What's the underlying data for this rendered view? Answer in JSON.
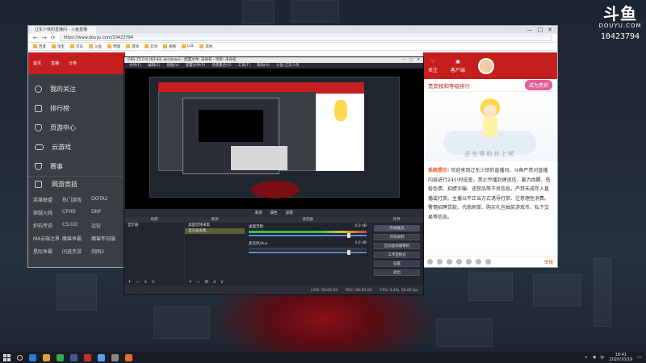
{
  "watermark": {
    "logo": "斗鱼",
    "site": "DOUYU.COM",
    "room": "10423794"
  },
  "browser": {
    "tab_title": "辽东少侠的直播间 - 斗鱼直播",
    "window_controls": [
      "—",
      "□",
      "✕"
    ],
    "nav": [
      "←",
      "→",
      "⟳"
    ],
    "url": "https://www.douyu.com/10423794",
    "bookmarks": [
      "百度",
      "淘宝",
      "京东",
      "斗鱼",
      "哔哩",
      "游戏",
      "云顶",
      "视频",
      "LOL",
      "其他"
    ]
  },
  "douyu_left": {
    "logo": "斗鱼",
    "topbar_items": [
      "首页",
      "直播",
      "分类"
    ],
    "nav": [
      {
        "icon": "heart-icon",
        "label": "我的关注"
      },
      {
        "icon": "rank-icon",
        "label": "排行榜"
      },
      {
        "icon": "shield-icon",
        "label": "页游中心"
      },
      {
        "icon": "gamepad-icon",
        "label": "云游戏"
      },
      {
        "icon": "trophy-icon",
        "label": "赛事"
      }
    ],
    "category_head": "网游竞技",
    "games": [
      "英雄联盟",
      "热门游戏",
      "DOTA2",
      "穿越火线",
      "CFHD",
      "DNF",
      "炉石传说",
      "CS:GO",
      "远征",
      "M4云端之界",
      "魔兽争霸",
      "魔兽怀旧服",
      "星际争霸",
      "问道手游",
      "剑网3"
    ]
  },
  "douyu_right": {
    "follow_label": "关注",
    "client_label": "客户端",
    "rank_tab": "贵宾榜和等级排行",
    "rank_button": "成为贵宾",
    "mascot_text": "还在等粉丝上榜",
    "system_tag": "系统提示:",
    "system_msg": "欢迎来到辽东少侠的直播间。斗鱼严禁对直播内容进行24小时巡查，禁止传播封建迷信、暴力血腥、低俗色情、招嫖诈骗、违禁品等不良信息。严禁未成年人直播或打赏。主播以不正当方式诱导打赏、注意理性消费。警惕招聘贷款、代练刷单、购买礼包抽奖游戏币、私下交易等信息。",
    "report_label": "举报"
  },
  "obs": {
    "title": "OBS 25.0.8 (64-bit, windows) - 配置文件: 未命名 - 场景: 未命名",
    "window_controls": [
      "—",
      "□",
      "✕"
    ],
    "menu": [
      "文件(F)",
      "编辑(E)",
      "视图(V)",
      "配置文件(P)",
      "场景集合(S)",
      "工具(T)",
      "帮助(H)",
      "斗鱼-辽东少侠"
    ],
    "preview_controls": [
      "来源",
      "属性",
      "滤镜"
    ],
    "docks": {
      "scenes_head": "场景",
      "scenes": [
        "显示器"
      ],
      "sources_head": "来源",
      "sources": [
        "桌面音频采集",
        "显示器采集"
      ],
      "mixer_head": "混音器",
      "mixer": [
        {
          "name": "桌面音频",
          "db": "0.0 dB"
        },
        {
          "name": "麦克风/Aux",
          "db": "0.0 dB"
        }
      ],
      "transition_head": "转场动画",
      "controls_head": "控件",
      "controls": [
        "开始推流",
        "开始录制",
        "启动虚拟摄像机",
        "工作室模式",
        "设置",
        "退出"
      ],
      "bottom_tabs": [
        "控件",
        "场景转换"
      ]
    },
    "status": [
      "LIVE: 00:00:00",
      "REC: 00:00:00",
      "CPU: 4.4%, 30.00 fps"
    ]
  },
  "taskbar": {
    "apps": [
      "#2b7bd3",
      "#e0a43a",
      "#34a853",
      "#3b5998",
      "#c83030",
      "#5aa0e6",
      "#888888",
      "#e56c2c"
    ],
    "time": "18:41",
    "date": "2020/10/19",
    "ime": "中"
  }
}
